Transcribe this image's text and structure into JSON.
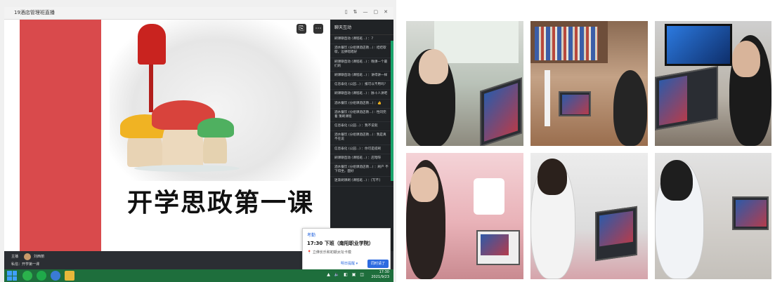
{
  "window": {
    "title": "19酒店管理班直播",
    "controls": [
      "▯",
      "⇅",
      "—",
      "▢",
      "✕"
    ]
  },
  "slide": {
    "headline": "开学思政第一课"
  },
  "chat": {
    "header": "聊天互动",
    "messages": [
      "刷课聊直动 (课程班...) ：7",
      "酒水餐饮 (分组课酒店教...) : 结结歇歇，边弹唱唱好",
      "刷课聊直动 (课程班...) ：晚课—个最们的",
      "刷课聊直动 (课程班...) ：讲得讲一样",
      "信息泰化 (公园...) ：报可以不用吗？",
      "刷课聊直动 (课程班...) ：脉十人讲吧",
      "酒水餐饮 (分组课酒店教...) ：👍",
      "酒水餐饮 (分组课酒店教...) : 性同完着 猜刷课程",
      "信息泰化 (公园...) ：我不说就",
      "酒水餐饮 (分组课酒店教...) : 我是真不在说",
      "信息泰化 (公园...) ：你可是提刷",
      "刷课聊直动 (课程班...) ：店暗呀",
      "酒水餐饮 (分组课酒店教...) ：刷产 不下得坐，面好",
      "迷渐刷课刷 (课程班...) ：[写不]"
    ]
  },
  "bottom_strip": {
    "host_label": "主播",
    "host_name": "刘西丽",
    "row2": "私信：开学第一课"
  },
  "popup": {
    "title": "考勤",
    "time": "17:30 下班（南阳职业学院）",
    "location": "📍 立佛长乐和初期太坛卡模",
    "btn_secondary": "明日提醒 ▾",
    "btn_primary": "同时请了"
  },
  "taskbar": {
    "tray_icons": "▲ 🔈 ◧ ▣ ◫",
    "time": "17:30",
    "date": "2021/9/23"
  },
  "colors": {
    "accent_red": "#d94a4c",
    "chat_bg": "#202326",
    "taskbar": "#1e6e3c",
    "link_blue": "#2d6be0"
  }
}
